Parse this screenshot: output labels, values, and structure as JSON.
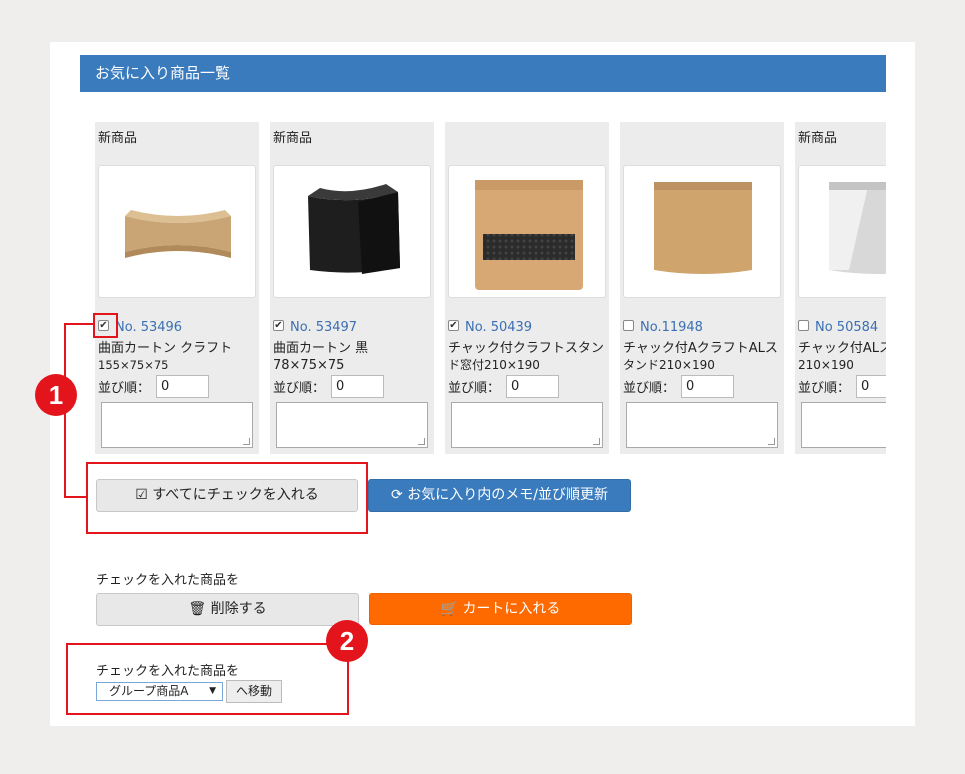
{
  "header": {
    "title": "お気に入り商品一覧"
  },
  "cards": [
    {
      "badge": "新商品",
      "checked": true,
      "no": "No. 53496",
      "name1": "曲面カートン クラフト",
      "name2": "155×75×75",
      "order_label": "並び順：",
      "order": "0",
      "image": "kraft-curved-carton"
    },
    {
      "badge": "新商品",
      "checked": true,
      "no": "No. 53497",
      "name1": "曲面カートン 黒 78×75×75",
      "name2": "",
      "order_label": "並び順：",
      "order": "0",
      "image": "black-curved-carton"
    },
    {
      "badge": "",
      "checked": true,
      "no": "No. 50439",
      "name1": "チャック付クラフトスタン",
      "name2": "ド窓付210×190",
      "order_label": "並び順：",
      "order": "0",
      "image": "kraft-window-pouch"
    },
    {
      "badge": "",
      "checked": false,
      "no": "No.11948",
      "name1": "チャック付AクラフトALス",
      "name2": "タンド210×190",
      "order_label": "並び順：",
      "order": "0",
      "image": "kraft-pouch"
    },
    {
      "badge": "新商品",
      "checked": false,
      "no": "No 50584",
      "name1": "チャック付ALス",
      "name2": "210×190",
      "order_label": "並び順：",
      "order": "0",
      "image": "silver-pouch"
    }
  ],
  "buttons": {
    "check_all": "すべてにチェックを入れる",
    "update_memo": "お気に入り内のメモ/並び順更新",
    "delete": "削除する",
    "add_cart": "カートに入れる",
    "move": "へ移動"
  },
  "labels": {
    "checked_items_1": "チェックを入れた商品を",
    "checked_items_2": "チェックを入れた商品を"
  },
  "group_select": {
    "value": "グループ商品A"
  },
  "markers": [
    "1",
    "2"
  ],
  "colors": {
    "accent": "#3a7bbd",
    "cart": "#ff6a00",
    "annotation": "#e3141b"
  }
}
